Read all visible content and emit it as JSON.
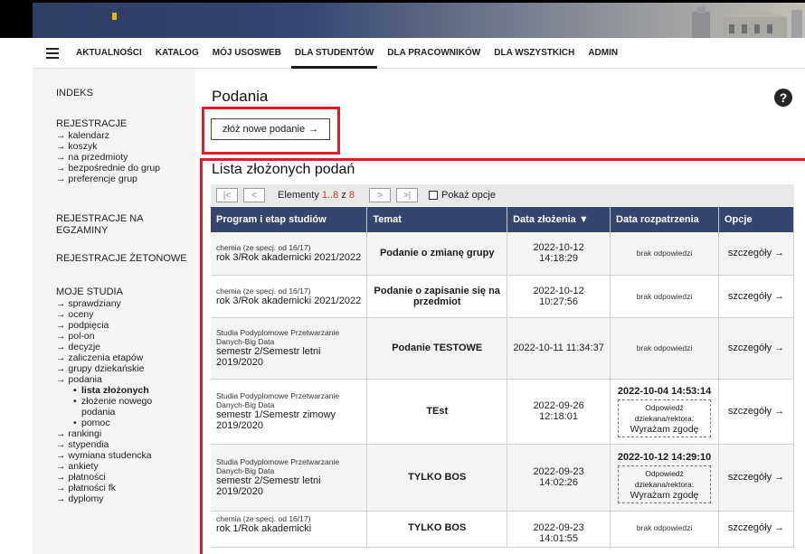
{
  "nav": {
    "items": [
      "AKTUALNOŚCI",
      "KATALOG",
      "MÓJ USOSWEB",
      "DLA STUDENTÓW",
      "DLA PRACOWNIKÓW",
      "DLA WSZYSTKICH",
      "ADMIN"
    ],
    "active": "DLA STUDENTÓW"
  },
  "sidebar": {
    "indeks": "INDEKS",
    "rejestracje": "REJESTRACJE",
    "rejestracje_items": [
      "kalendarz",
      "koszyk",
      "na przedmioty",
      "bezpośrednie do grup",
      "preferencje grup"
    ],
    "rejestracje_egzaminy_1": "REJESTRACJE NA",
    "rejestracje_egzaminy_2": "EGZAMINY",
    "rejestracje_zetonowe": "REJESTRACJE ŻETONOWE",
    "moje_studia": "MOJE STUDIA",
    "studia_items": [
      "sprawdziany",
      "oceny",
      "podpięcia",
      "pol-on",
      "decyzje",
      "zaliczenia etapów",
      "grupy dziekańskie",
      "podania"
    ],
    "podania_sub": [
      "lista złożonych",
      "złożenie nowego",
      "podania",
      "pomoc"
    ],
    "studia_items_2": [
      "rankingi",
      "stypendia",
      "wymiana studencka",
      "ankiety",
      "płatności",
      "płatności fk",
      "dyplomy"
    ]
  },
  "main": {
    "title": "Podania",
    "new_button": "złóż nowe podanie",
    "list_title": "Lista złożonych podań"
  },
  "pager": {
    "label": "Elementy",
    "range": "1..8",
    "of": "z",
    "total": "8",
    "show_options": "Pokaż opcje"
  },
  "table": {
    "headers": [
      "Program i etap studiów",
      "Temat",
      "Data złożenia",
      "Data rozpatrzenia",
      "Opcje"
    ],
    "rows": [
      {
        "prog_small": "chemia (ze specj. od 16/17)",
        "prog_big": "rok 3/Rok akademicki 2021/2022",
        "topic": "Podanie o zmianę grupy",
        "date": "2022-10-12 14:18:29",
        "resp": "brak odpowiedzi",
        "opt": "szczegóły"
      },
      {
        "prog_small": "chemia (ze specj. od 16/17)",
        "prog_big": "rok 3/Rok akademicki 2021/2022",
        "topic": "Podanie o zapisanie się na przedmiot",
        "date": "2022-10-12 10:27:56",
        "resp": "brak odpowiedzi",
        "opt": "szczegóły"
      },
      {
        "prog_small": "Studia Podyplomowe Przetwarzanie Danych-Big Data",
        "prog_big": "semestr 2/Semestr letni 2019/2020",
        "topic": "Podanie TESTOWE",
        "date": "2022-10-11 11:34:37",
        "resp": "brak odpowiedzi",
        "opt": "szczegóły"
      },
      {
        "prog_small": "Studia Podyplomowe Przetwarzanie Danych-Big Data",
        "prog_big": "semestr 1/Semestr zimowy 2019/2020",
        "topic": "TEst",
        "date": "2022-09-26 12:18:01",
        "resp_date": "2022-10-04 14:53:14",
        "resp_label": "Odpowiedź dziekana/rektora:",
        "resp_value": "Wyrażam zgodę",
        "opt": "szczegóły"
      },
      {
        "prog_small": "Studia Podyplomowe Przetwarzanie Danych-Big Data",
        "prog_big": "semestr 2/Semestr letni 2019/2020",
        "topic": "TYLKO BOS",
        "date": "2022-09-23 14:02:26",
        "resp_date": "2022-10-12 14:29:10",
        "resp_label": "Odpowiedź dziekana/rektora:",
        "resp_value": "Wyrażam zgodę",
        "opt": "szczegóły"
      },
      {
        "prog_small": "chemia (ze specj. od 16/17)",
        "prog_big": "rok 1/Rok akademicki",
        "topic": "TYLKO BOS",
        "date": "2022-09-23 14:01:55",
        "resp": "brak odpowiedzi",
        "opt": "szczegóły"
      }
    ]
  },
  "colors": {
    "header_bg": "#34466e",
    "highlight": "#e01b24",
    "sidebar_bg": "#f4f4f4"
  }
}
